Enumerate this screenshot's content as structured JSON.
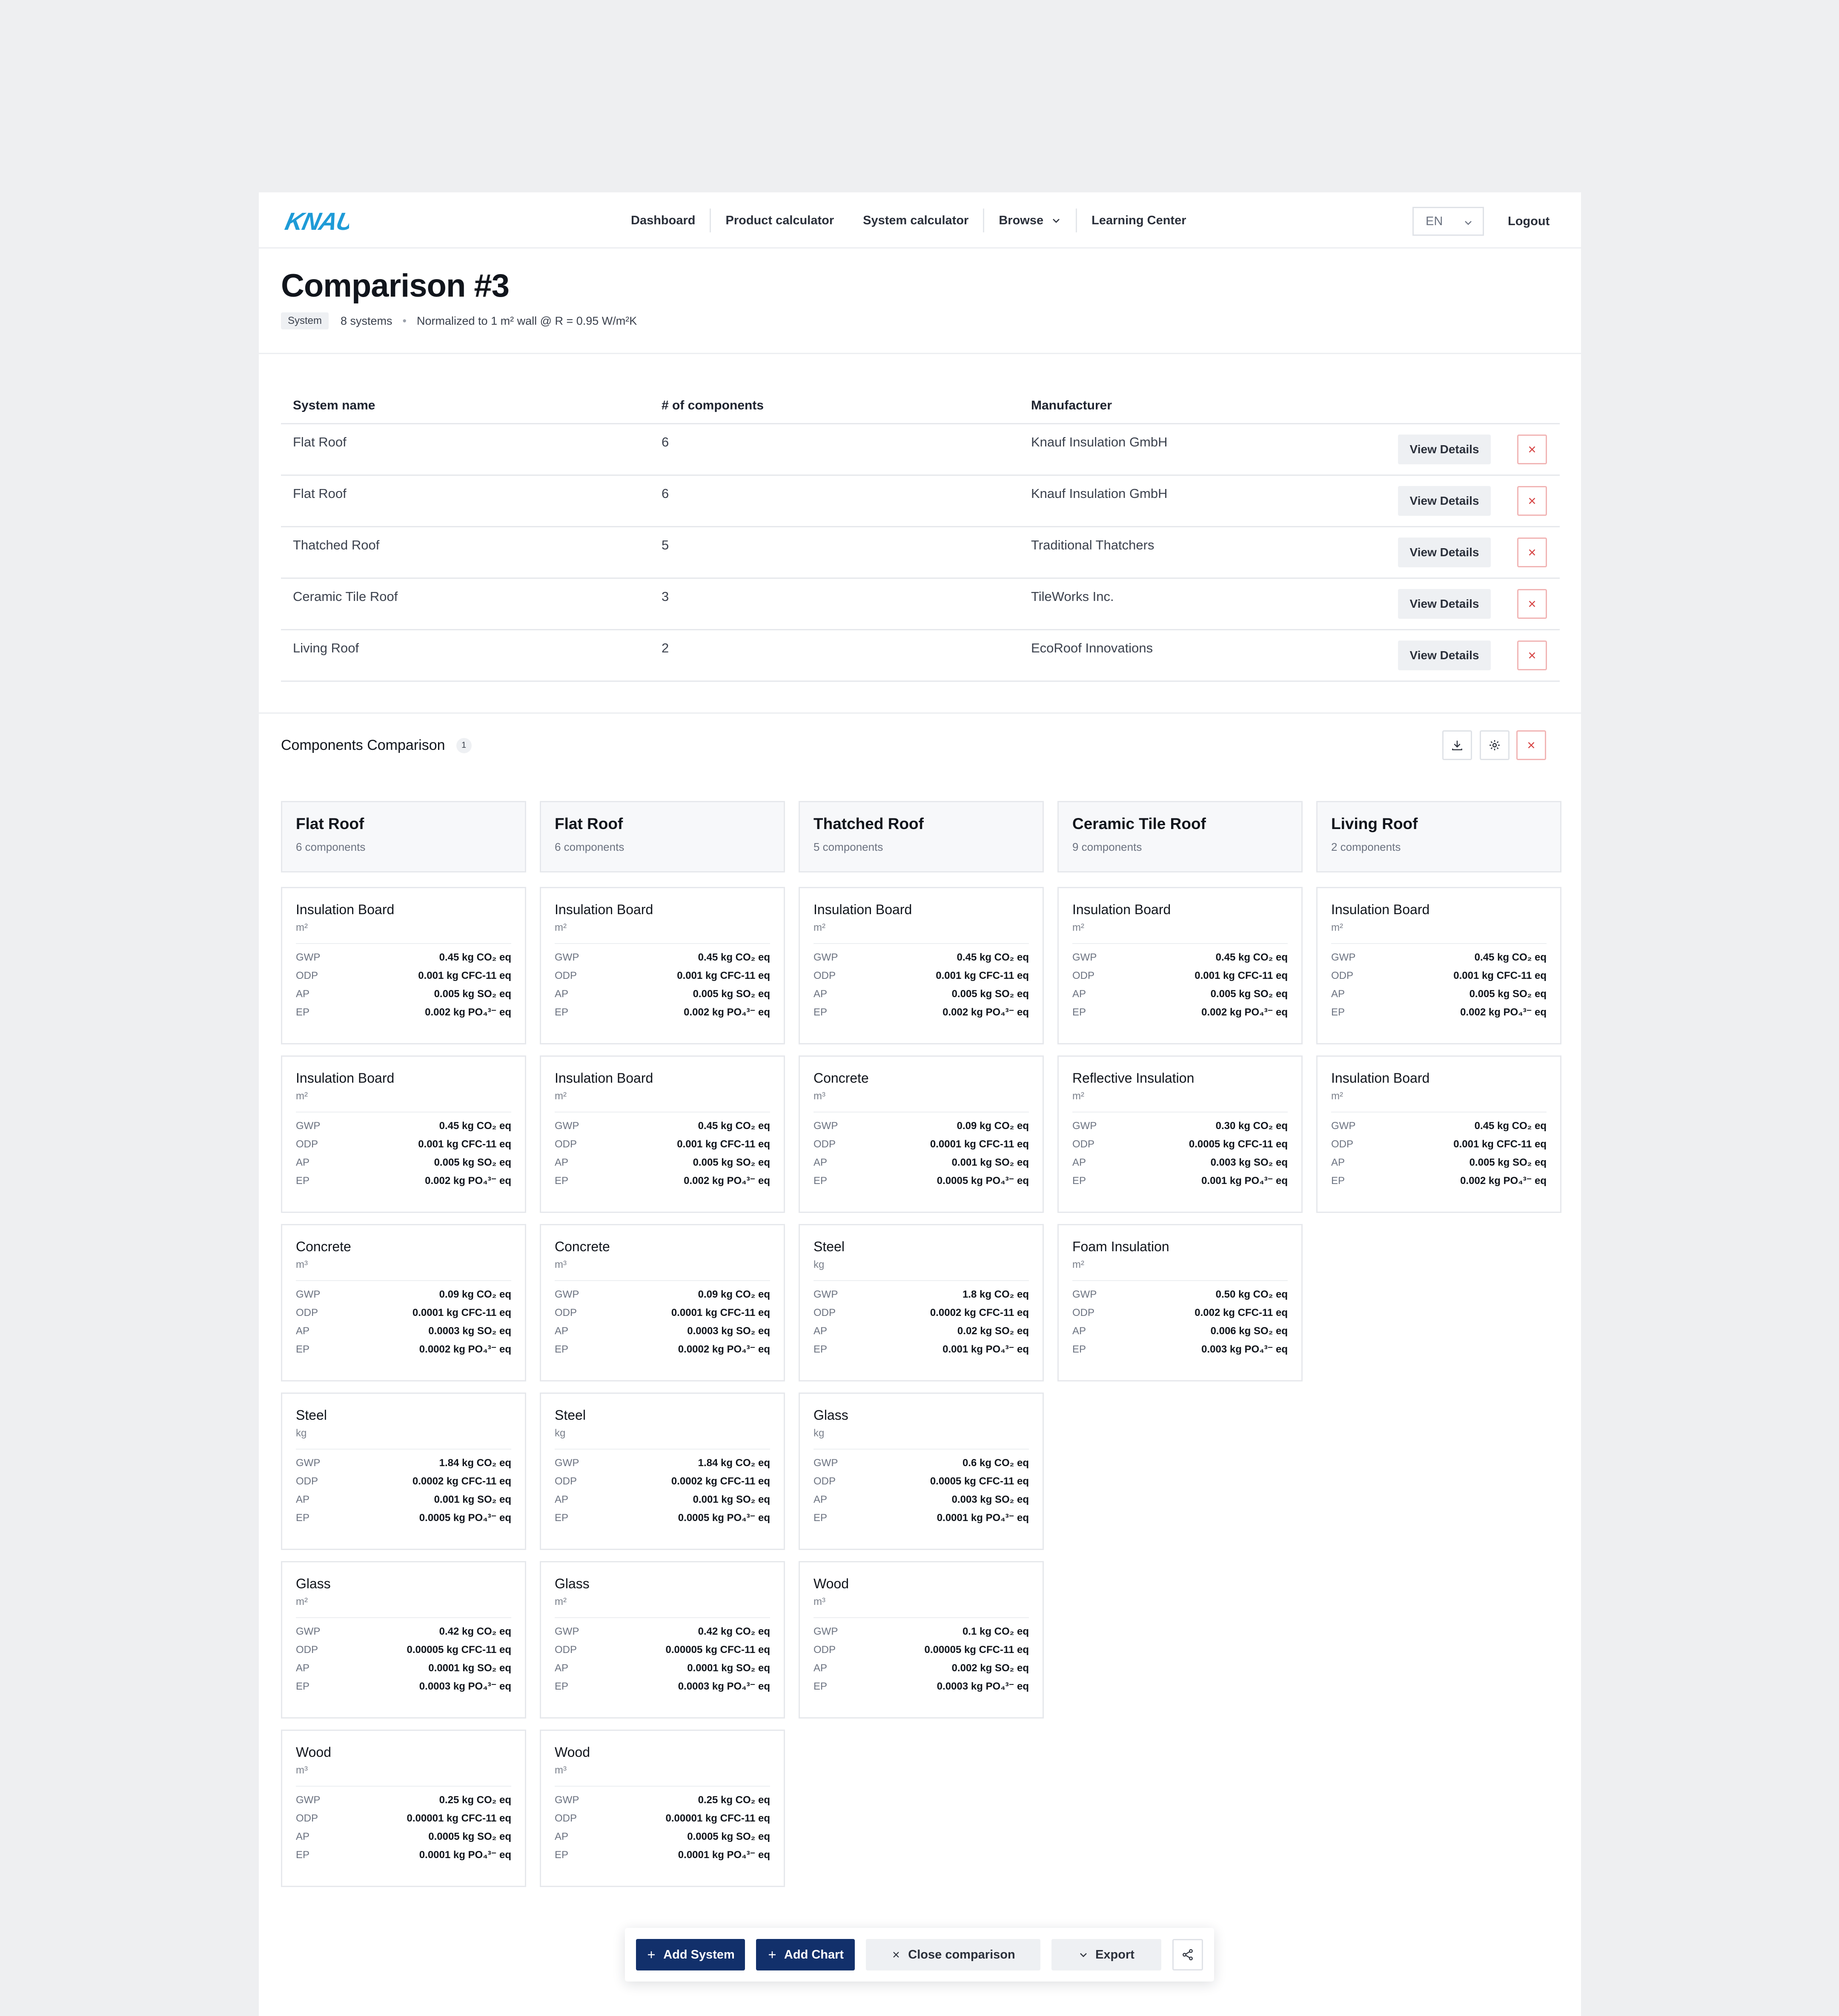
{
  "brand": {
    "logo_text": "KNAUF",
    "color": "#1e9bd7"
  },
  "nav": {
    "items": [
      {
        "label": "Dashboard"
      },
      {
        "label": "Product calculator"
      },
      {
        "label": "System calculator"
      },
      {
        "label": "Browse"
      },
      {
        "label": "Learning Center"
      }
    ],
    "language": "EN",
    "logout": "Logout"
  },
  "header": {
    "title": "Comparison #3",
    "badge": "System",
    "systems_count": "8 systems",
    "normalization": "Normalized to 1 m² wall @ R = 0.95 W/m²K"
  },
  "table": {
    "columns": [
      "System name",
      "# of components",
      "Manufacturer"
    ],
    "view_label": "View Details",
    "rows": [
      {
        "name": "Flat Roof",
        "components": "6",
        "manufacturer": "Knauf Insulation GmbH"
      },
      {
        "name": "Flat Roof",
        "components": "6",
        "manufacturer": "Knauf Insulation GmbH"
      },
      {
        "name": "Thatched Roof",
        "components": "5",
        "manufacturer": "Traditional Thatchers"
      },
      {
        "name": "Ceramic Tile Roof",
        "components": "3",
        "manufacturer": "TileWorks Inc."
      },
      {
        "name": "Living Roof",
        "components": "2",
        "manufacturer": "EcoRoof Innovations"
      }
    ]
  },
  "components": {
    "title": "Components Comparison",
    "count": "1",
    "metric_keys": [
      "GWP",
      "ODP",
      "AP",
      "EP"
    ],
    "columns": [
      {
        "name": "Flat Roof",
        "count": "6 components",
        "cards": [
          {
            "name": "Insulation Board",
            "unit": "m²",
            "values": [
              "0.45 kg CO₂ eq",
              "0.001 kg CFC-11 eq",
              "0.005 kg SO₂ eq",
              "0.002 kg PO₄³⁻ eq"
            ]
          },
          {
            "name": "Insulation Board",
            "unit": "m²",
            "values": [
              "0.45 kg CO₂ eq",
              "0.001 kg CFC-11 eq",
              "0.005 kg SO₂ eq",
              "0.002 kg PO₄³⁻ eq"
            ]
          },
          {
            "name": "Concrete",
            "unit": "m³",
            "values": [
              "0.09 kg CO₂ eq",
              "0.0001 kg CFC-11 eq",
              "0.0003 kg SO₂ eq",
              "0.0002 kg PO₄³⁻ eq"
            ]
          },
          {
            "name": "Steel",
            "unit": "kg",
            "values": [
              "1.84 kg CO₂ eq",
              "0.0002 kg CFC-11 eq",
              "0.001 kg SO₂ eq",
              "0.0005 kg PO₄³⁻ eq"
            ]
          },
          {
            "name": "Glass",
            "unit": "m²",
            "values": [
              "0.42 kg CO₂ eq",
              "0.00005 kg CFC-11 eq",
              "0.0001 kg SO₂ eq",
              "0.0003 kg PO₄³⁻ eq"
            ]
          },
          {
            "name": "Wood",
            "unit": "m³",
            "values": [
              "0.25 kg CO₂ eq",
              "0.00001 kg CFC-11 eq",
              "0.0005 kg SO₂ eq",
              "0.0001 kg PO₄³⁻ eq"
            ]
          }
        ]
      },
      {
        "name": "Flat Roof",
        "count": "6 components",
        "cards": [
          {
            "name": "Insulation Board",
            "unit": "m²",
            "values": [
              "0.45 kg CO₂ eq",
              "0.001 kg CFC-11 eq",
              "0.005 kg SO₂ eq",
              "0.002 kg PO₄³⁻ eq"
            ]
          },
          {
            "name": "Insulation Board",
            "unit": "m²",
            "values": [
              "0.45 kg CO₂ eq",
              "0.001 kg CFC-11 eq",
              "0.005 kg SO₂ eq",
              "0.002 kg PO₄³⁻ eq"
            ]
          },
          {
            "name": "Concrete",
            "unit": "m³",
            "values": [
              "0.09 kg CO₂ eq",
              "0.0001 kg CFC-11 eq",
              "0.0003 kg SO₂ eq",
              "0.0002 kg PO₄³⁻ eq"
            ]
          },
          {
            "name": "Steel",
            "unit": "kg",
            "values": [
              "1.84 kg CO₂ eq",
              "0.0002 kg CFC-11 eq",
              "0.001 kg SO₂ eq",
              "0.0005 kg PO₄³⁻ eq"
            ]
          },
          {
            "name": "Glass",
            "unit": "m²",
            "values": [
              "0.42 kg CO₂ eq",
              "0.00005 kg CFC-11 eq",
              "0.0001 kg SO₂ eq",
              "0.0003 kg PO₄³⁻ eq"
            ]
          },
          {
            "name": "Wood",
            "unit": "m³",
            "values": [
              "0.25 kg CO₂ eq",
              "0.00001 kg CFC-11 eq",
              "0.0005 kg SO₂ eq",
              "0.0001 kg PO₄³⁻ eq"
            ]
          }
        ]
      },
      {
        "name": "Thatched Roof",
        "count": "5 components",
        "cards": [
          {
            "name": "Insulation Board",
            "unit": "m²",
            "values": [
              "0.45 kg CO₂ eq",
              "0.001 kg CFC-11 eq",
              "0.005 kg SO₂ eq",
              "0.002 kg PO₄³⁻ eq"
            ]
          },
          {
            "name": "Concrete",
            "unit": "m³",
            "values": [
              "0.09 kg CO₂ eq",
              "0.0001 kg CFC-11 eq",
              "0.001 kg SO₂ eq",
              "0.0005 kg PO₄³⁻ eq"
            ]
          },
          {
            "name": "Steel",
            "unit": "kg",
            "values": [
              "1.8 kg CO₂ eq",
              "0.0002 kg CFC-11 eq",
              "0.02 kg SO₂ eq",
              "0.001 kg PO₄³⁻ eq"
            ]
          },
          {
            "name": "Glass",
            "unit": "kg",
            "values": [
              "0.6 kg CO₂ eq",
              "0.0005 kg CFC-11 eq",
              "0.003 kg SO₂ eq",
              "0.0001 kg PO₄³⁻ eq"
            ]
          },
          {
            "name": "Wood",
            "unit": "m³",
            "values": [
              "0.1 kg CO₂ eq",
              "0.00005 kg CFC-11 eq",
              "0.002 kg SO₂ eq",
              "0.0003 kg PO₄³⁻ eq"
            ]
          }
        ]
      },
      {
        "name": "Ceramic Tile Roof",
        "count": "9 components",
        "cards": [
          {
            "name": "Insulation Board",
            "unit": "m²",
            "values": [
              "0.45 kg CO₂ eq",
              "0.001 kg CFC-11 eq",
              "0.005 kg SO₂ eq",
              "0.002 kg PO₄³⁻ eq"
            ]
          },
          {
            "name": "Reflective Insulation",
            "unit": "m²",
            "values": [
              "0.30 kg CO₂ eq",
              "0.0005 kg CFC-11 eq",
              "0.003 kg SO₂ eq",
              "0.001 kg PO₄³⁻ eq"
            ]
          },
          {
            "name": "Foam Insulation",
            "unit": "m²",
            "values": [
              "0.50 kg CO₂ eq",
              "0.002 kg CFC-11 eq",
              "0.006 kg SO₂ eq",
              "0.003 kg PO₄³⁻ eq"
            ]
          }
        ]
      },
      {
        "name": "Living Roof",
        "count": "2 components",
        "cards": [
          {
            "name": "Insulation Board",
            "unit": "m²",
            "values": [
              "0.45 kg CO₂ eq",
              "0.001 kg CFC-11 eq",
              "0.005 kg SO₂ eq",
              "0.002 kg PO₄³⁻ eq"
            ]
          },
          {
            "name": "Insulation Board",
            "unit": "m²",
            "values": [
              "0.45 kg CO₂ eq",
              "0.001 kg CFC-11 eq",
              "0.005 kg SO₂ eq",
              "0.002 kg PO₄³⁻ eq"
            ]
          }
        ]
      }
    ]
  },
  "actions": {
    "add_system": "Add System",
    "add_chart": "Add Chart",
    "close": "Close comparison",
    "export": "Export"
  },
  "colors": {
    "primary": "#12306b",
    "danger": "#e05252",
    "brand": "#1e9bd7"
  }
}
